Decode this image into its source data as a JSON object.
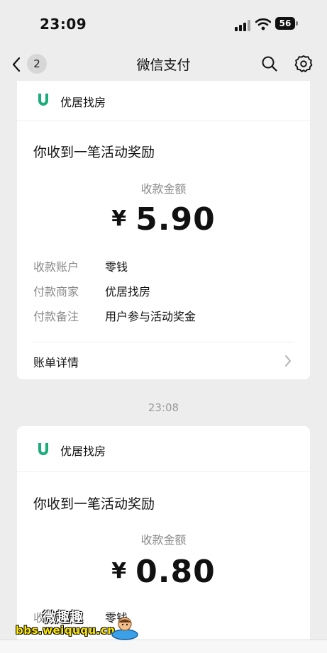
{
  "status_bar": {
    "time": "23:09",
    "battery": "56"
  },
  "nav": {
    "back_count": "2",
    "title": "微信支付"
  },
  "cards": [
    {
      "merchant": "优居找房",
      "title": "你收到一笔活动奖励",
      "amount_label": "收款金额",
      "currency": "¥",
      "amount": "5.90",
      "rows": [
        {
          "key": "收款账户",
          "value": "零钱"
        },
        {
          "key": "付款商家",
          "value": "优居找房"
        },
        {
          "key": "付款备注",
          "value": "用户参与活动奖金"
        }
      ],
      "detail_label": "账单详情"
    },
    {
      "merchant": "优居找房",
      "title": "你收到一笔活动奖励",
      "amount_label": "收款金额",
      "currency": "¥",
      "amount": "0.80",
      "rows": [
        {
          "key": "收款账户",
          "value": "零钱"
        }
      ]
    }
  ],
  "timestamp": "23:08",
  "watermark": {
    "title": "微趣趣",
    "url": "bbs.weiququ.cn"
  },
  "colors": {
    "brand": "#1aad7a",
    "background": "#ededed"
  },
  "icons": [
    "back-chevron-icon",
    "search-icon",
    "gear-icon",
    "chevron-right-icon",
    "merchant-logo-icon"
  ]
}
